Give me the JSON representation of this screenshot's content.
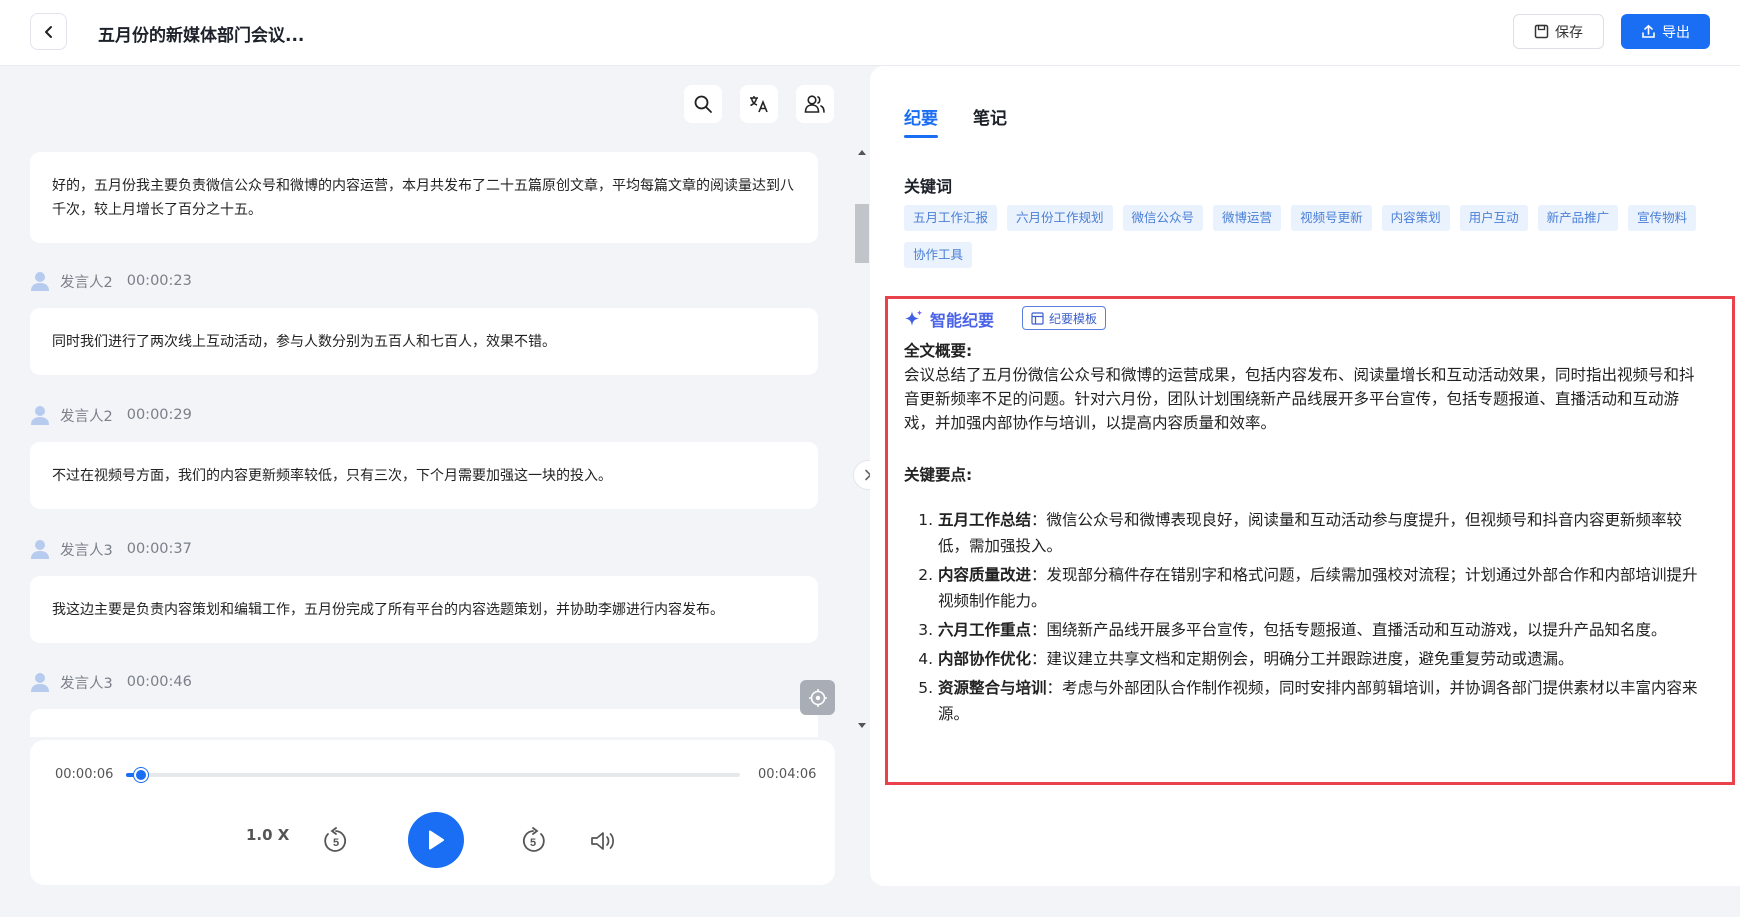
{
  "header": {
    "title": "五月份的新媒体部门会议...",
    "save_label": "保存",
    "export_label": "导出"
  },
  "transcript": {
    "entries": [
      {
        "text": "好的，五月份我主要负责微信公众号和微博的内容运营，本月共发布了二十五篇原创文章，平均每篇文章的阅读量达到八千次，较上月增长了百分之十五。"
      },
      {
        "speaker": "发言人2",
        "time": "00:00:23",
        "text": "同时我们进行了两次线上互动活动，参与人数分别为五百人和七百人，效果不错。"
      },
      {
        "speaker": "发言人2",
        "time": "00:00:29",
        "text": "不过在视频号方面，我们的内容更新频率较低，只有三次，下个月需要加强这一块的投入。"
      },
      {
        "speaker": "发言人3",
        "time": "00:00:37",
        "text": "我这边主要是负责内容策划和编辑工作，五月份完成了所有平台的内容选题策划，并协助李娜进行内容发布。"
      },
      {
        "speaker": "发言人3",
        "time": "00:00:46",
        "text": ""
      }
    ]
  },
  "player": {
    "current_time": "00:00:06",
    "total_time": "00:04:06",
    "progress": 0.024,
    "speed": "1.0 X",
    "rewind_seconds": "5",
    "forward_seconds": "5"
  },
  "tabs": [
    "纪要",
    "笔记"
  ],
  "keywords_title": "关键词",
  "keywords": [
    "五月工作汇报",
    "六月份工作规划",
    "微信公众号",
    "微博运营",
    "视频号更新",
    "内容策划",
    "用户互动",
    "新产品推广",
    "宣传物料",
    "协作工具"
  ],
  "summary": {
    "ai_title": "智能纪要",
    "template_label": "纪要模板",
    "overview_label": "全文概要:",
    "overview_text": "会议总结了五月份微信公众号和微博的运营成果，包括内容发布、阅读量增长和互动活动效果，同时指出视频号和抖音更新频率不足的问题。针对六月份，团队计划围绕新产品线展开多平台宣传，包括专题报道、直播活动和互动游戏，并加强内部协作与培训，以提高内容质量和效率。",
    "points_label": "关键要点:",
    "points": [
      {
        "title": "五月工作总结",
        "text": "：微信公众号和微博表现良好，阅读量和互动活动参与度提升，但视频号和抖音内容更新频率较低，需加强投入。"
      },
      {
        "title": "内容质量改进",
        "text": "：发现部分稿件存在错别字和格式问题，后续需加强校对流程；计划通过外部合作和内部培训提升视频制作能力。"
      },
      {
        "title": "六月工作重点",
        "text": "：围绕新产品线开展多平台宣传，包括专题报道、直播活动和互动游戏，以提升产品知名度。"
      },
      {
        "title": "内部协作优化",
        "text": "：建议建立共享文档和定期例会，明确分工并跟踪进度，避免重复劳动或遗漏。"
      },
      {
        "title": "资源整合与培训",
        "text": "：考虑与外部团队合作制作视频，同时安排内部剪辑培训，并协调各部门提供素材以丰富内容来源。"
      }
    ]
  },
  "colors": {
    "accent": "#1a6ef3",
    "highlight_border": "#e9424d",
    "keyword_bg": "#eaf2fd"
  },
  "icons": [
    "back-icon",
    "save-icon",
    "export-icon",
    "search-icon",
    "translate-icon",
    "speakers-icon",
    "avatar-icon",
    "locate-icon",
    "chevron-right-icon",
    "rewind-5-icon",
    "play-icon",
    "forward-5-icon",
    "volume-icon",
    "sparkle-icon",
    "template-icon"
  ]
}
